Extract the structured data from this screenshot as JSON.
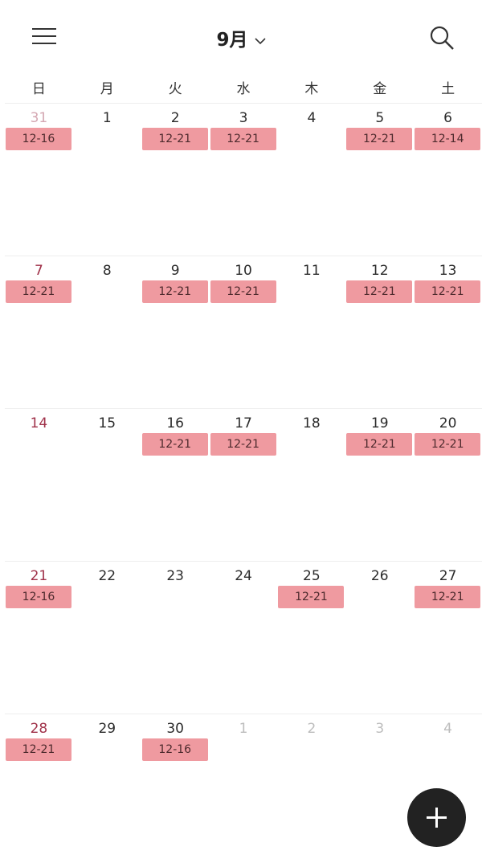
{
  "header": {
    "month_label": "9月",
    "menu_icon": "menu-icon",
    "dropdown_icon": "chevron-down-icon",
    "search_icon": "search-icon"
  },
  "weekdays": [
    "日",
    "月",
    "火",
    "水",
    "木",
    "金",
    "土"
  ],
  "weeks": [
    {
      "days": [
        {
          "num": "31",
          "state": "muted-sun",
          "event": "12-16"
        },
        {
          "num": "1",
          "state": "normal",
          "event": ""
        },
        {
          "num": "2",
          "state": "normal",
          "event": "12-21"
        },
        {
          "num": "3",
          "state": "normal",
          "event": "12-21"
        },
        {
          "num": "4",
          "state": "normal",
          "event": ""
        },
        {
          "num": "5",
          "state": "normal",
          "event": "12-21"
        },
        {
          "num": "6",
          "state": "normal",
          "event": "12-14"
        }
      ]
    },
    {
      "days": [
        {
          "num": "7",
          "state": "sun",
          "event": "12-21"
        },
        {
          "num": "8",
          "state": "normal",
          "event": ""
        },
        {
          "num": "9",
          "state": "normal",
          "event": "12-21"
        },
        {
          "num": "10",
          "state": "normal",
          "event": "12-21"
        },
        {
          "num": "11",
          "state": "normal",
          "event": ""
        },
        {
          "num": "12",
          "state": "normal",
          "event": "12-21"
        },
        {
          "num": "13",
          "state": "normal",
          "event": "12-21"
        }
      ]
    },
    {
      "days": [
        {
          "num": "14",
          "state": "sun",
          "event": ""
        },
        {
          "num": "15",
          "state": "normal",
          "event": ""
        },
        {
          "num": "16",
          "state": "normal",
          "event": "12-21"
        },
        {
          "num": "17",
          "state": "normal",
          "event": "12-21"
        },
        {
          "num": "18",
          "state": "normal",
          "event": ""
        },
        {
          "num": "19",
          "state": "normal",
          "event": "12-21"
        },
        {
          "num": "20",
          "state": "normal",
          "event": "12-21"
        }
      ]
    },
    {
      "days": [
        {
          "num": "21",
          "state": "sun",
          "event": "12-16"
        },
        {
          "num": "22",
          "state": "normal",
          "event": ""
        },
        {
          "num": "23",
          "state": "normal",
          "event": ""
        },
        {
          "num": "24",
          "state": "normal",
          "event": ""
        },
        {
          "num": "25",
          "state": "normal",
          "event": "12-21"
        },
        {
          "num": "26",
          "state": "normal",
          "event": ""
        },
        {
          "num": "27",
          "state": "normal",
          "event": "12-21"
        }
      ]
    },
    {
      "days": [
        {
          "num": "28",
          "state": "sun",
          "event": "12-21"
        },
        {
          "num": "29",
          "state": "normal",
          "event": ""
        },
        {
          "num": "30",
          "state": "normal",
          "event": "12-16"
        },
        {
          "num": "1",
          "state": "muted",
          "event": ""
        },
        {
          "num": "2",
          "state": "muted",
          "event": ""
        },
        {
          "num": "3",
          "state": "muted",
          "event": ""
        },
        {
          "num": "4",
          "state": "muted",
          "event": ""
        }
      ]
    }
  ],
  "fab": {
    "icon": "plus-icon"
  },
  "colors": {
    "event_bg": "#ef9aa0",
    "event_text": "#4d2a2d",
    "sunday": "#a0324a",
    "fab_bg": "#222222"
  }
}
